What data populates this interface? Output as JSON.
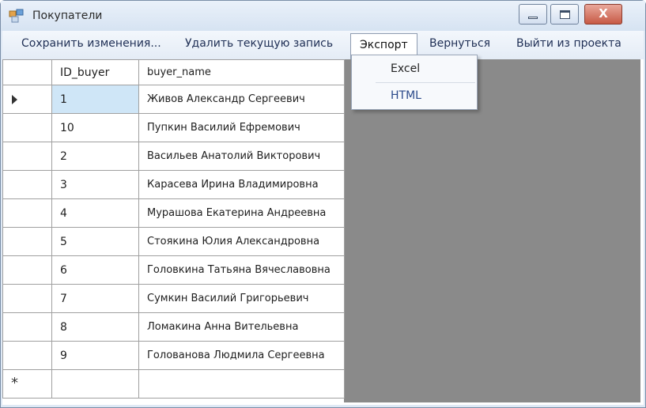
{
  "window": {
    "title": "Покупатели",
    "close_glyph": "X"
  },
  "menu": {
    "save": "Сохранить изменения...",
    "delete": "Удалить текущую запись",
    "export": "Экспорт",
    "back": "Вернуться",
    "exit": "Выйти из проекта"
  },
  "export_menu": {
    "excel": "Excel",
    "html": "HTML"
  },
  "grid": {
    "columns": [
      "ID_buyer",
      "buyer_name"
    ],
    "rows": [
      [
        "1",
        "Живов Александр Сергеевич"
      ],
      [
        "10",
        "Пупкин Василий Ефремович"
      ],
      [
        "2",
        "Васильев Анатолий Викторович"
      ],
      [
        "3",
        "Карасева Ирина Владимировна"
      ],
      [
        "4",
        "Мурашова Екатерина Андреевна"
      ],
      [
        "5",
        "Стоякина Юлия Александровна"
      ],
      [
        "6",
        "Головкина Татьяна Вячеславовна"
      ],
      [
        "7",
        "Сумкин Василий Григорьевич"
      ],
      [
        "8",
        "Ломакина Анна Вительевна"
      ],
      [
        "9",
        "Голованова Людмила Сергеевна"
      ]
    ],
    "new_row_marker": "*"
  }
}
